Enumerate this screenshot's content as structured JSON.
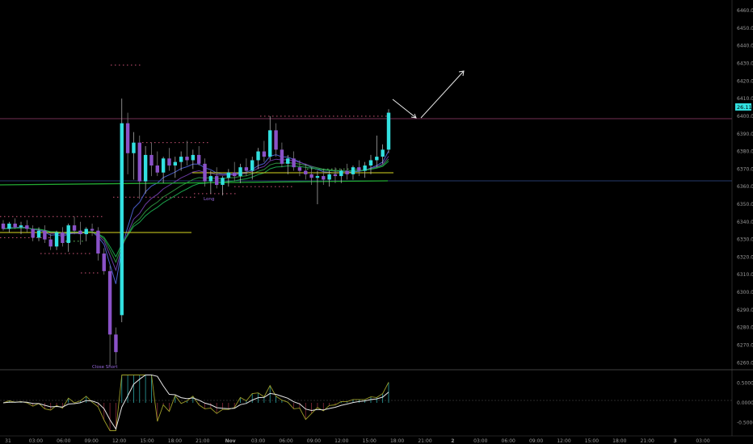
{
  "colors": {
    "background": "#000000",
    "bull": "#32e0e0",
    "bear": "#8a52c8",
    "yellow": "#d8d820",
    "green": "#22aa33",
    "annotation": "#ffffff",
    "level": "#cc66cc"
  },
  "chart_data": [
    {
      "type": "candlestick",
      "price_axis": {
        "ticks": [
          "6460.00",
          "6450.00",
          "6440.00",
          "6430.00",
          "6420.00",
          "6410.00",
          "6400.00",
          "6390.00",
          "6380.00",
          "6370.00",
          "6360.00",
          "6350.00",
          "6340.00",
          "6330.00",
          "6320.00",
          "6310.00",
          "6300.00",
          "6290.00",
          "6280.00",
          "6270.00",
          "6260.00"
        ],
        "ylim": [
          6256,
          6466
        ]
      },
      "last_price_tag": "26.11",
      "time_axis": [
        "31",
        "03:00",
        "06:00",
        "09:00",
        "12:00",
        "15:00",
        "18:00",
        "21:00",
        "Nov",
        "03:00",
        "06:00",
        "09:00",
        "12:00",
        "15:00",
        "18:00",
        "21:00",
        "2",
        "03:00",
        "06:00",
        "09:00",
        "12:00",
        "15:00",
        "18:00",
        "21:00",
        "3",
        "03:00"
      ],
      "labels": {
        "close_short": "Close Short",
        "small_tag": "Long"
      },
      "candles": [
        [
          6339,
          6341,
          6335,
          6336
        ],
        [
          6336,
          6340,
          6334,
          6339
        ],
        [
          6339,
          6342,
          6336,
          6337
        ],
        [
          6337,
          6340,
          6333,
          6338
        ],
        [
          6338,
          6341,
          6334,
          6336
        ],
        [
          6336,
          6338,
          6329,
          6331
        ],
        [
          6331,
          6337,
          6329,
          6335
        ],
        [
          6335,
          6338,
          6328,
          6330
        ],
        [
          6330,
          6333,
          6324,
          6326
        ],
        [
          6326,
          6335,
          6324,
          6334
        ],
        [
          6334,
          6337,
          6326,
          6328
        ],
        [
          6328,
          6339,
          6323,
          6338
        ],
        [
          6338,
          6343,
          6333,
          6335
        ],
        [
          6335,
          6340,
          6327,
          6333
        ],
        [
          6333,
          6337,
          6329,
          6336
        ],
        [
          6336,
          6339,
          6332,
          6335
        ],
        [
          6335,
          6337,
          6318,
          6322
        ],
        [
          6322,
          6325,
          6310,
          6312
        ],
        [
          6312,
          6315,
          6258,
          6276
        ],
        [
          6276,
          6280,
          6259,
          6266
        ],
        [
          6287,
          6410,
          6283,
          6396
        ],
        [
          6396,
          6402,
          6367,
          6379
        ],
        [
          6379,
          6391,
          6364,
          6385
        ],
        [
          6385,
          6389,
          6353,
          6363
        ],
        [
          6363,
          6383,
          6356,
          6378
        ],
        [
          6378,
          6385,
          6366,
          6372
        ],
        [
          6372,
          6380,
          6366,
          6368
        ],
        [
          6368,
          6377,
          6362,
          6376
        ],
        [
          6376,
          6382,
          6369,
          6372
        ],
        [
          6372,
          6377,
          6365,
          6374
        ],
        [
          6374,
          6380,
          6369,
          6377
        ],
        [
          6377,
          6386,
          6372,
          6375
        ],
        [
          6375,
          6381,
          6370,
          6378
        ],
        [
          6378,
          6383,
          6372,
          6373
        ],
        [
          6373,
          6376,
          6360,
          6363
        ],
        [
          6363,
          6369,
          6356,
          6366
        ],
        [
          6366,
          6371,
          6359,
          6361
        ],
        [
          6361,
          6366,
          6355,
          6365
        ],
        [
          6365,
          6370,
          6360,
          6368
        ],
        [
          6368,
          6374,
          6363,
          6366
        ],
        [
          6366,
          6373,
          6362,
          6371
        ],
        [
          6371,
          6376,
          6366,
          6369
        ],
        [
          6369,
          6377,
          6364,
          6375
        ],
        [
          6375,
          6382,
          6370,
          6380
        ],
        [
          6380,
          6386,
          6374,
          6377
        ],
        [
          6377,
          6400,
          6375,
          6392
        ],
        [
          6392,
          6396,
          6377,
          6381
        ],
        [
          6381,
          6385,
          6371,
          6373
        ],
        [
          6373,
          6378,
          6367,
          6376
        ],
        [
          6376,
          6380,
          6369,
          6371
        ],
        [
          6371,
          6375,
          6366,
          6369
        ],
        [
          6369,
          6373,
          6364,
          6367
        ],
        [
          6367,
          6371,
          6361,
          6365
        ],
        [
          6365,
          6369,
          6350,
          6366
        ],
        [
          6366,
          6370,
          6361,
          6364
        ],
        [
          6364,
          6369,
          6360,
          6367
        ],
        [
          6367,
          6371,
          6362,
          6366
        ],
        [
          6366,
          6370,
          6362,
          6369
        ],
        [
          6369,
          6373,
          6364,
          6367
        ],
        [
          6367,
          6372,
          6364,
          6371
        ],
        [
          6371,
          6375,
          6366,
          6369
        ],
        [
          6369,
          6374,
          6365,
          6372
        ],
        [
          6372,
          6378,
          6367,
          6375
        ],
        [
          6375,
          6389,
          6371,
          6377
        ],
        [
          6377,
          6384,
          6373,
          6381
        ],
        [
          6381,
          6404,
          6379,
          6402
        ]
      ],
      "lines": [
        {
          "price": 6400,
          "color": "#cc66cc"
        },
        {
          "price": 6363,
          "color": "#4466cc"
        }
      ]
    },
    {
      "type": "oscillator",
      "ticks": [
        "0.5000",
        "0.0000",
        "-0.5000"
      ],
      "ylim": [
        -0.75,
        0.75
      ]
    }
  ]
}
